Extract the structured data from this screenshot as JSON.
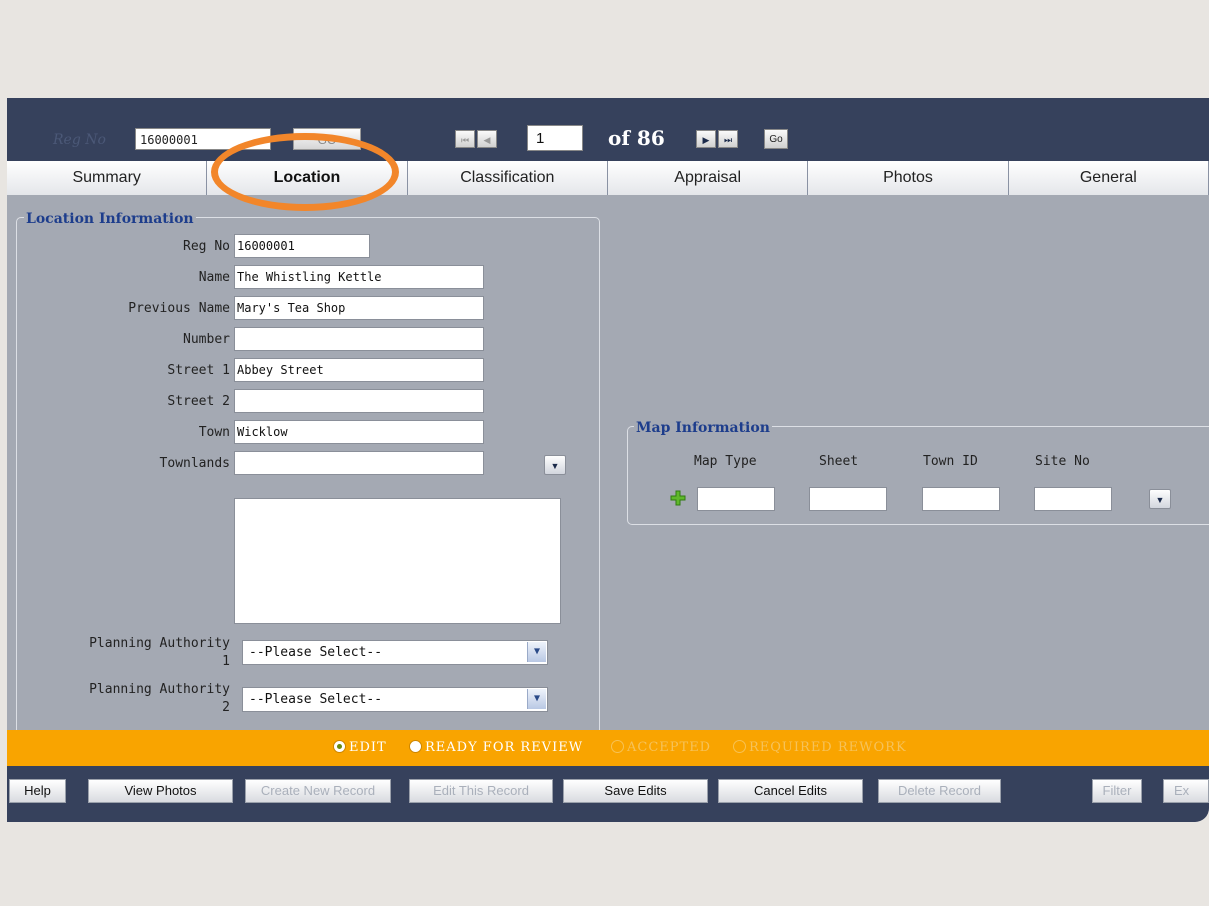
{
  "header": {
    "reg_label": "Reg No",
    "reg_value": "16000001",
    "go_label": "GO",
    "first_icon": "first-page-icon",
    "prev_icon": "prev-page-icon",
    "page_value": "1",
    "of_label": "of 86",
    "next_icon": "next-page-icon",
    "last_icon": "last-page-icon",
    "page_go_label": "Go"
  },
  "tabs": [
    {
      "label": "Summary"
    },
    {
      "label": "Location"
    },
    {
      "label": "Classification"
    },
    {
      "label": "Appraisal"
    },
    {
      "label": "Photos"
    },
    {
      "label": "General"
    }
  ],
  "active_tab": "Location",
  "location": {
    "legend": "Location Information",
    "fields": [
      {
        "label": "Reg No",
        "value": "16000001"
      },
      {
        "label": "Name",
        "value": "The Whistling Kettle"
      },
      {
        "label": "Previous Name",
        "value": "Mary's Tea Shop"
      },
      {
        "label": "Number",
        "value": ""
      },
      {
        "label": "Street 1",
        "value": "Abbey Street"
      },
      {
        "label": "Street 2",
        "value": ""
      },
      {
        "label": "Town",
        "value": "Wicklow"
      },
      {
        "label": "Townlands",
        "value": ""
      }
    ],
    "planning1": {
      "label_line1": "Planning Authority",
      "label_line2": "1",
      "value": "--Please Select--"
    },
    "planning2": {
      "label_line1": "Planning Authority",
      "label_line2": "2",
      "value": "--Please Select--"
    }
  },
  "map": {
    "legend": "Map Information",
    "columns": [
      "Map Type",
      "Sheet",
      "Town ID",
      "Site No"
    ],
    "values": [
      "",
      "",
      "",
      ""
    ],
    "add_icon": "plus-icon"
  },
  "status": [
    {
      "label": "EDIT",
      "selected": true
    },
    {
      "label": "READY FOR REVIEW",
      "selected": false
    },
    {
      "label": "ACCEPTED",
      "selected": false
    },
    {
      "label": "REQUIRED REWORK",
      "selected": false
    }
  ],
  "buttons": [
    {
      "label": "Help",
      "enabled": true
    },
    {
      "label": "View Photos",
      "enabled": true
    },
    {
      "label": "Create New Record",
      "enabled": false
    },
    {
      "label": "Edit This Record",
      "enabled": false
    },
    {
      "label": "Save Edits",
      "enabled": true
    },
    {
      "label": "Cancel Edits",
      "enabled": true
    },
    {
      "label": "Delete Record",
      "enabled": false
    },
    {
      "label": "Filter",
      "enabled": false
    },
    {
      "label": "Ex",
      "enabled": false
    }
  ],
  "colors": {
    "header_bg": "#36415c",
    "panel_bg": "#a4a9b3",
    "status_bg": "#f9a400",
    "legend_text": "#1d3d8c",
    "highlight_oval": "#f2862a"
  }
}
